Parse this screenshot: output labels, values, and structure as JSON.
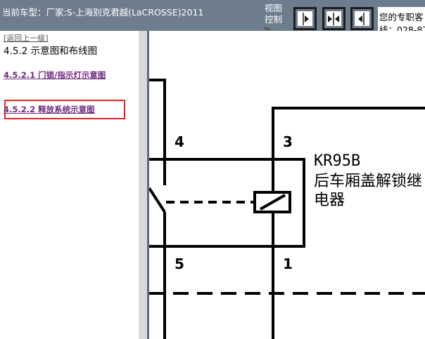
{
  "topbar": {
    "car_title": "当前车型：厂家:S-上海别克君越(LaCROSSE)2011",
    "view_label": "视图控制",
    "support_line1": "您的专职客",
    "support_line2": "线：028-87"
  },
  "view_buttons": [
    {
      "name": "view-next-button",
      "icon": "play-right-icon"
    },
    {
      "name": "view-fit-button",
      "icon": "collapse-icon"
    },
    {
      "name": "view-prev-button",
      "icon": "play-left-icon"
    }
  ],
  "left_panel": {
    "back_link": "[返回上一级]",
    "section_title": "4.5.2 示意图和布线图",
    "toc": [
      {
        "label": "4.5.2.1 门锁/指示灯示意图"
      },
      {
        "label": "4.5.2.2 释放系统示意图",
        "selected": true
      }
    ]
  },
  "diagram": {
    "pins": [
      "4",
      "3",
      "5",
      "1"
    ],
    "relay_code": "KR95B",
    "relay_name": "后车厢盖解锁继电器"
  },
  "colors": {
    "topbar_bg": "#6e7d8e",
    "link_color": "#6c2a7c",
    "highlight_border": "#e42222"
  }
}
